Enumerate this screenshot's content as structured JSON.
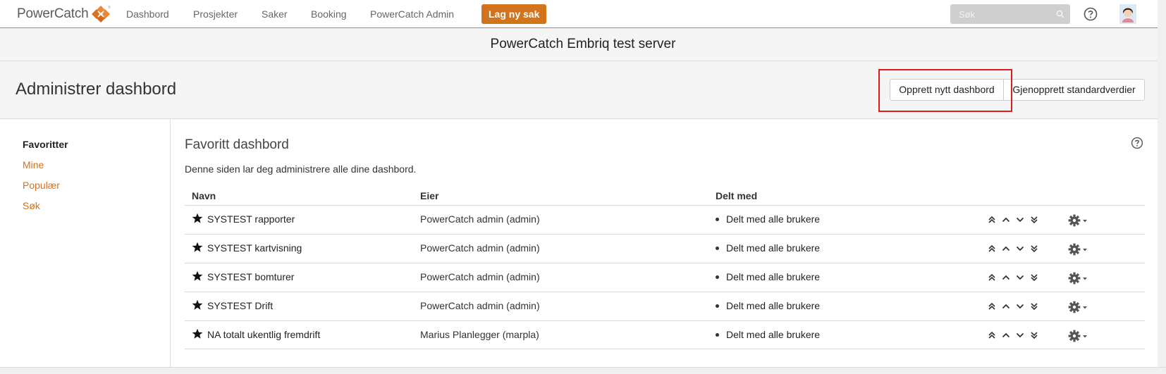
{
  "nav": {
    "logo_text": "PowerCatch",
    "items": [
      {
        "label": "Dashbord"
      },
      {
        "label": "Prosjekter"
      },
      {
        "label": "Saker"
      },
      {
        "label": "Booking"
      },
      {
        "label": "PowerCatch Admin"
      }
    ],
    "create_label": "Lag ny sak",
    "search_placeholder": "Søk"
  },
  "banner": {
    "title": "PowerCatch Embriq test server"
  },
  "header": {
    "title": "Administrer dashbord",
    "new_button": "Opprett nytt dashbord",
    "restore_button": "Gjenopprett standardverdier"
  },
  "sidebar": {
    "items": [
      {
        "label": "Favoritter"
      },
      {
        "label": "Mine"
      },
      {
        "label": "Populær"
      },
      {
        "label": "Søk"
      }
    ]
  },
  "main": {
    "title": "Favoritt dashbord",
    "description": "Denne siden lar deg administrere alle dine dashbord.",
    "columns": {
      "name": "Navn",
      "owner": "Eier",
      "shared": "Delt med"
    },
    "rows": [
      {
        "name": "SYSTEST rapporter",
        "owner": "PowerCatch admin (admin)",
        "shared": "Delt med alle brukere"
      },
      {
        "name": "SYSTEST kartvisning",
        "owner": "PowerCatch admin (admin)",
        "shared": "Delt med alle brukere"
      },
      {
        "name": "SYSTEST bomturer",
        "owner": "PowerCatch admin (admin)",
        "shared": "Delt med alle brukere"
      },
      {
        "name": "SYSTEST Drift",
        "owner": "PowerCatch admin (admin)",
        "shared": "Delt med alle brukere"
      },
      {
        "name": "NA totalt ukentlig fremdrift",
        "owner": "Marius Planlegger (marpla)",
        "shared": "Delt med alle brukere"
      }
    ]
  },
  "colors": {
    "accent": "#d1741d",
    "highlight": "#e21a1a"
  },
  "icons": [
    "search-icon",
    "help-icon",
    "avatar",
    "star-icon",
    "move-top-icon",
    "move-up-icon",
    "move-down-icon",
    "move-bottom-icon",
    "gear-icon"
  ]
}
